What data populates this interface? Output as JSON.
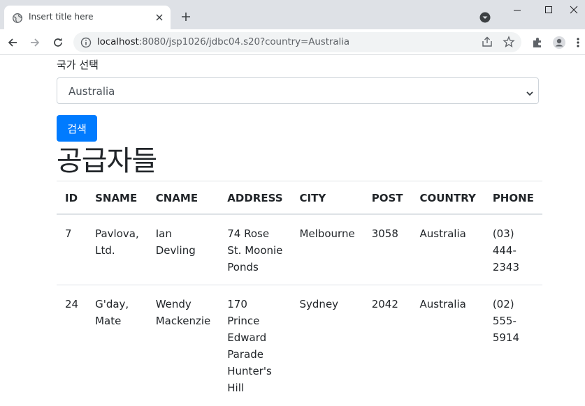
{
  "browser": {
    "tab_title": "Insert title here",
    "url_host": "localhost",
    "url_rest": ":8080/jsp1026/jdbc04.s20?country=Australia"
  },
  "form": {
    "label": "국가 선택",
    "selected_country": "Australia",
    "search_button": "검색"
  },
  "heading": "공급자들",
  "table": {
    "headers": [
      "ID",
      "SNAME",
      "CNAME",
      "ADDRESS",
      "CITY",
      "POST",
      "COUNTRY",
      "PHONE"
    ],
    "rows": [
      {
        "id": "7",
        "sname": "Pavlova, Ltd.",
        "cname": "Ian Devling",
        "address": "74 Rose St. Moonie Ponds",
        "city": "Melbourne",
        "post": "3058",
        "country": "Australia",
        "phone": "(03) 444-2343"
      },
      {
        "id": "24",
        "sname": "G'day, Mate",
        "cname": "Wendy Mackenzie",
        "address": "170 Prince Edward Parade Hunter's Hill",
        "city": "Sydney",
        "post": "2042",
        "country": "Australia",
        "phone": "(02) 555-5914"
      }
    ]
  },
  "colors": {
    "primary_button": "#007bff",
    "tabbar_bg": "#dee1e6"
  }
}
